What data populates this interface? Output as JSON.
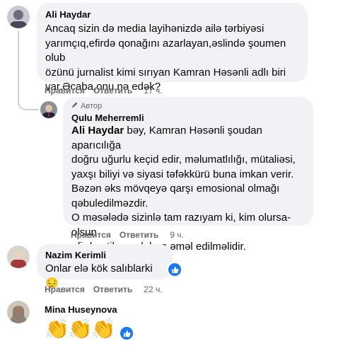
{
  "comments": [
    {
      "author": "Ali Haydar",
      "text": "Ancaq sizin də media layihənizdə ailə tərbiyəsi\nyarımçıq,efirdə qonağını azarlayan,əslində şoumen olub\nözünü jurnalist kimi sırıyan Kamran Həsənli adlı biri\nvar.Əcaba,onu nə edək?",
      "like_label": "Нравится",
      "reply_label": "Ответить",
      "time": "17 ч."
    },
    {
      "author_tag": "Автор",
      "author": "Qulu Meherremli",
      "mention": "Ali Haydar",
      "text_after_mention": " bəy, Kamran Həsənli şoudan aparıcılığa\ndoğru uğurlu keçid edir, məlumatlılığı, mütaliəsi,\nyaxşı biliyi və siyasi təfəkkürü buna imkan verir.\nBəzən əks mövqeyə qarşı emosional olmağı\nqəbuledilməzdir.\nO məsələdə sizinlə tam razıyam ki, kim olursa-olsun\nefirdə etik qaydalara əməl edilməlidir.",
      "like_label": "Нравится",
      "reply_label": "Ответить",
      "time": "9 ч."
    },
    {
      "author": "Nazim Kerimli",
      "text": "Onlar elə kök salıblarki 😔",
      "like_label": "Нравится",
      "reply_label": "Ответить",
      "time": "22 ч."
    },
    {
      "author": "Mina Huseynova",
      "text": "👏👏👏"
    }
  ],
  "colors": {
    "bubble": "#f0f2f5",
    "secondary_text": "#65676b",
    "like_blue": "#1877f2"
  },
  "icons": [
    "pencil-icon",
    "like-icon",
    "clap-emoji"
  ]
}
